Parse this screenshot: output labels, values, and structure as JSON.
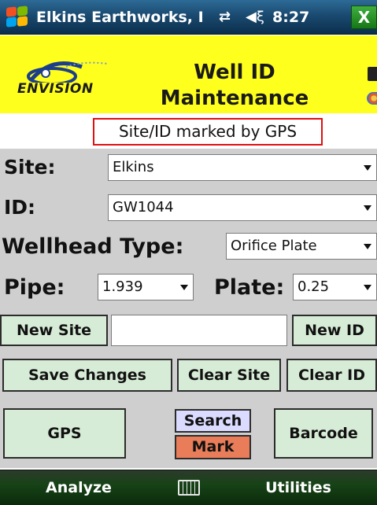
{
  "titlebar": {
    "title": "Elkins Earthworks, I",
    "time": "8:27",
    "close_label": "X",
    "icons": [
      "windows-logo-icon",
      "connectivity-icon",
      "speaker-icon"
    ]
  },
  "header": {
    "logo_text": "ENVISION",
    "title_line1": "Well ID",
    "title_line2": "Maintenance",
    "background": "#ffff1e"
  },
  "status_message": "Site/ID marked by GPS",
  "form": {
    "site_label": "Site:",
    "site_value": "Elkins",
    "id_label": "ID:",
    "id_value": "GW1044",
    "wellhead_label": "Wellhead Type:",
    "wellhead_value": "Orifice Plate",
    "pipe_label": "Pipe:",
    "pipe_value": "1.939",
    "plate_label": "Plate:",
    "plate_value": "0.25",
    "new_entry_value": ""
  },
  "buttons": {
    "new_site": "New Site",
    "new_id": "New ID",
    "save_changes": "Save Changes",
    "clear_site": "Clear Site",
    "clear_id": "Clear ID",
    "gps": "GPS",
    "search": "Search",
    "mark": "Mark",
    "barcode": "Barcode"
  },
  "colors": {
    "button_bg": "#d7ecd7",
    "search_bg": "#dbdbff",
    "mark_bg": "#e97d5a",
    "status_border": "#e01010",
    "form_bg": "#cfcfcf"
  },
  "menubar": {
    "left": "Analyze",
    "right": "Utilities",
    "center_icon": "keyboard-icon"
  }
}
